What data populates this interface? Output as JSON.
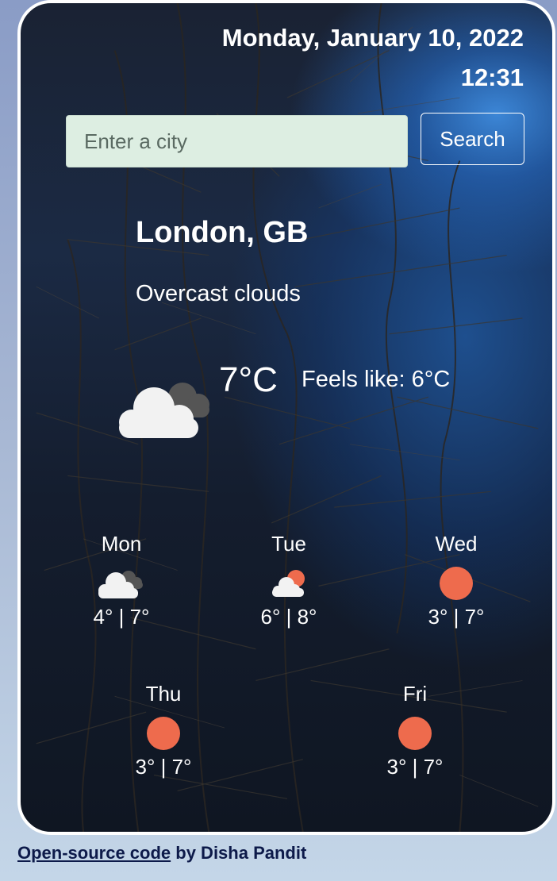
{
  "header": {
    "date": "Monday, January 10, 2022",
    "time": "12:31"
  },
  "search": {
    "placeholder": "Enter a city",
    "value": "",
    "button_label": "Search"
  },
  "current": {
    "city": "London, GB",
    "description": "Overcast clouds",
    "icon": "overcast-clouds-icon",
    "temperature": "7°C",
    "feels_like": "Feels like: 6°C"
  },
  "forecast": [
    {
      "day": "Mon",
      "icon": "overcast-clouds-icon",
      "temps": "4° | 7°"
    },
    {
      "day": "Tue",
      "icon": "partly-cloudy-icon",
      "temps": "6° | 8°"
    },
    {
      "day": "Wed",
      "icon": "sun-icon",
      "temps": "3° | 7°"
    },
    {
      "day": "Thu",
      "icon": "sun-icon",
      "temps": "3° | 7°"
    },
    {
      "day": "Fri",
      "icon": "sun-icon",
      "temps": "3° | 7°"
    }
  ],
  "footer": {
    "link_text": "Open-source code",
    "suffix": " by Disha Pandit"
  },
  "colors": {
    "sun": "#ee6b4d",
    "cloud_light": "#f2f2f2",
    "cloud_dark": "#555555",
    "input_bg": "#ddeee2"
  }
}
